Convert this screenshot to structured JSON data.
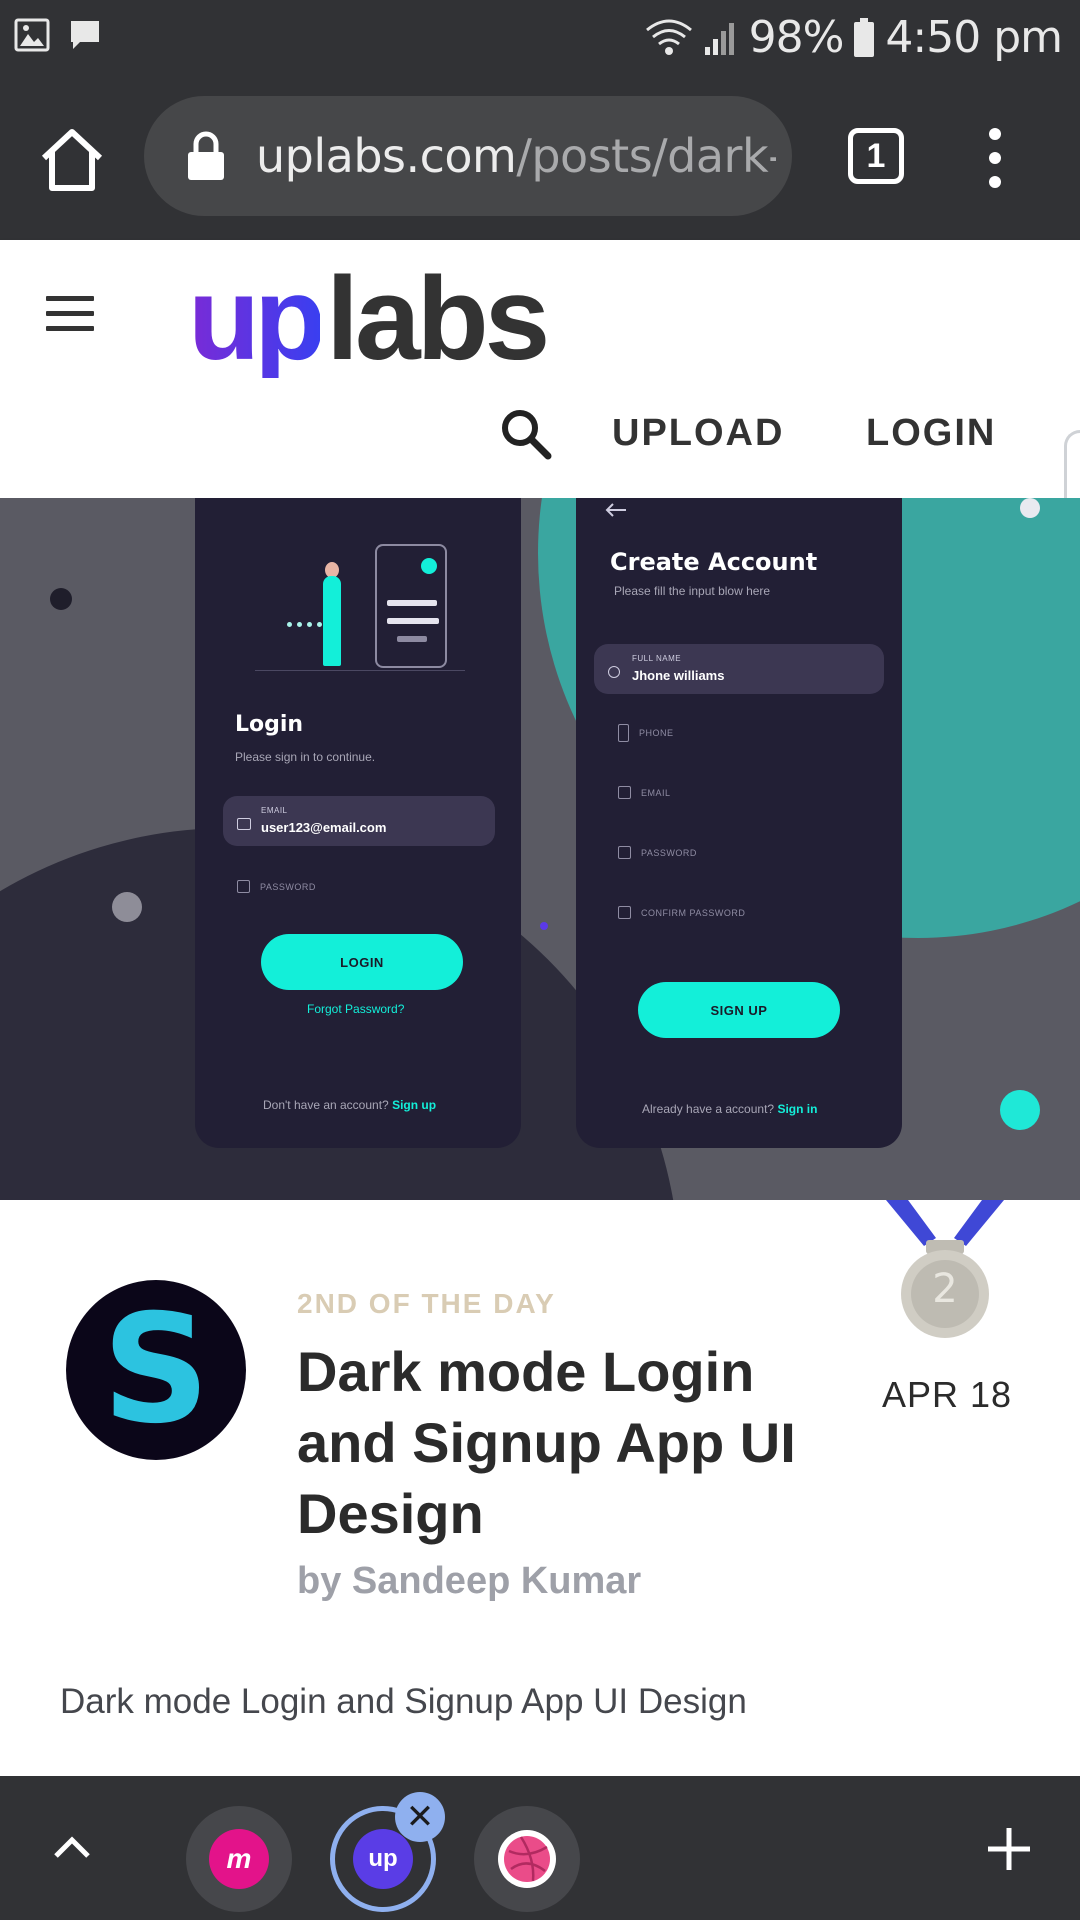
{
  "status_bar": {
    "battery": "98%",
    "time": "4:50 pm",
    "icons": [
      "image-icon",
      "chat-icon",
      "wifi-icon",
      "signal-icon",
      "battery-icon"
    ]
  },
  "browser": {
    "url_domain": "uplabs.com",
    "url_path": "/posts/dark-",
    "tab_count": "1",
    "icons": [
      "home-icon",
      "lock-icon",
      "tabs-icon",
      "more-vert-icon"
    ]
  },
  "site": {
    "logo_up": "up",
    "logo_labs": "labs",
    "nav_upload": "UPLOAD",
    "nav_login": "LOGIN"
  },
  "hero": {
    "login_screen": {
      "title": "Login",
      "subtitle": "Please sign in to continue.",
      "email_label": "EMAIL",
      "email_value": "user123@email.com",
      "password_label": "PASSWORD",
      "button": "LOGIN",
      "forgot": "Forgot Password?",
      "footer_text": "Don't have an account?",
      "footer_link": "Sign up"
    },
    "signup_screen": {
      "title": "Create Account",
      "subtitle": "Please fill the input blow here",
      "fullname_label": "FULL NAME",
      "fullname_value": "Jhone williams",
      "phone_label": "PHONE",
      "email_label": "EMAIL",
      "password_label": "PASSWORD",
      "confirm_label": "CONFIRM PASSWORD",
      "button": "SIGN UP",
      "footer_text": "Already have a account?",
      "footer_link": "Sign in"
    }
  },
  "post": {
    "rank": "2ND OF THE DAY",
    "medal_number": "2",
    "title": "Dark mode Login and Signup App UI Design",
    "author": "by Sandeep Kumar",
    "date": "APR 18",
    "description": "Dark mode Login and Signup App UI Design"
  },
  "bottom_bar": {
    "tab_active_label": "up",
    "tab_m_label": "m",
    "close_symbol": "✕"
  },
  "colors": {
    "chrome_dark": "#313235",
    "accent_teal": "#13efd9",
    "brand_purple": "#5a2ee3"
  }
}
